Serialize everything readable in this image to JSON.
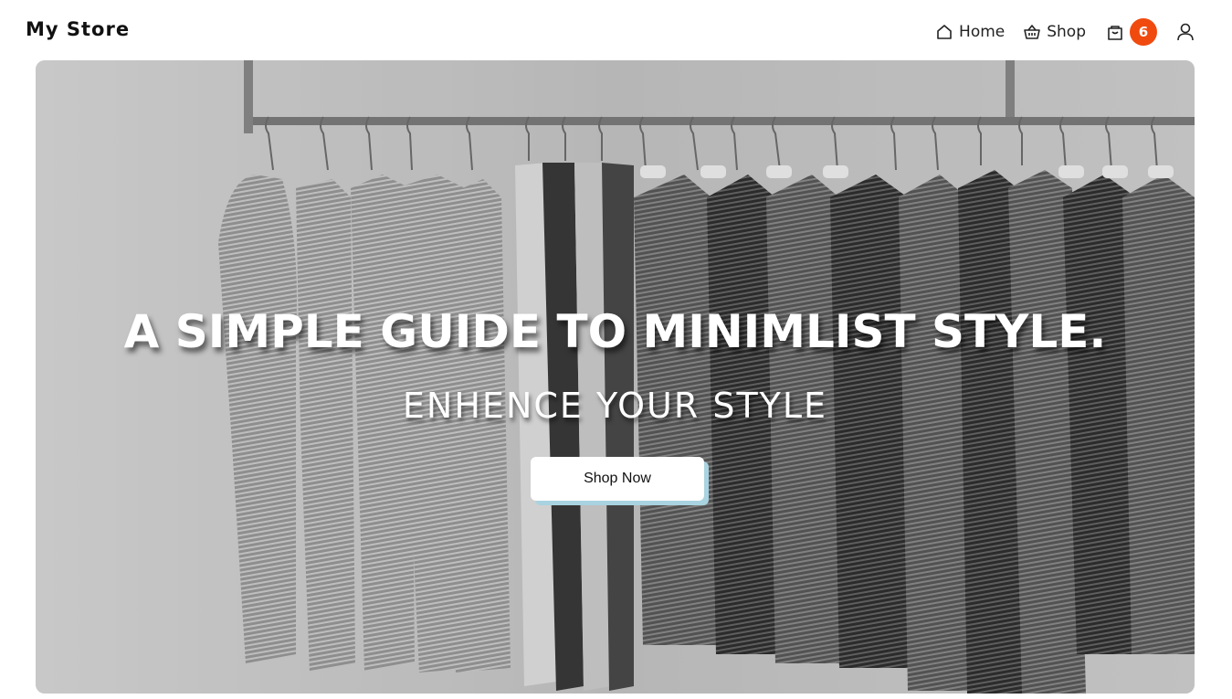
{
  "navbar": {
    "brand": "My Store",
    "links": [
      {
        "label": "Home",
        "icon": "home-icon"
      },
      {
        "label": "Shop",
        "icon": "basket-icon"
      }
    ],
    "cart": {
      "icon": "shopping-bag-icon",
      "count": "6",
      "badge_color": "#f04a0f"
    },
    "account": {
      "icon": "user-icon"
    }
  },
  "hero": {
    "title": "A SIMPLE GUIDE TO MINIMLIST STYLE.",
    "subtitle": "ENHENCE YOUR STYLE",
    "cta_label": "Shop Now",
    "cta_shadow_color": "#a9d3e0"
  }
}
